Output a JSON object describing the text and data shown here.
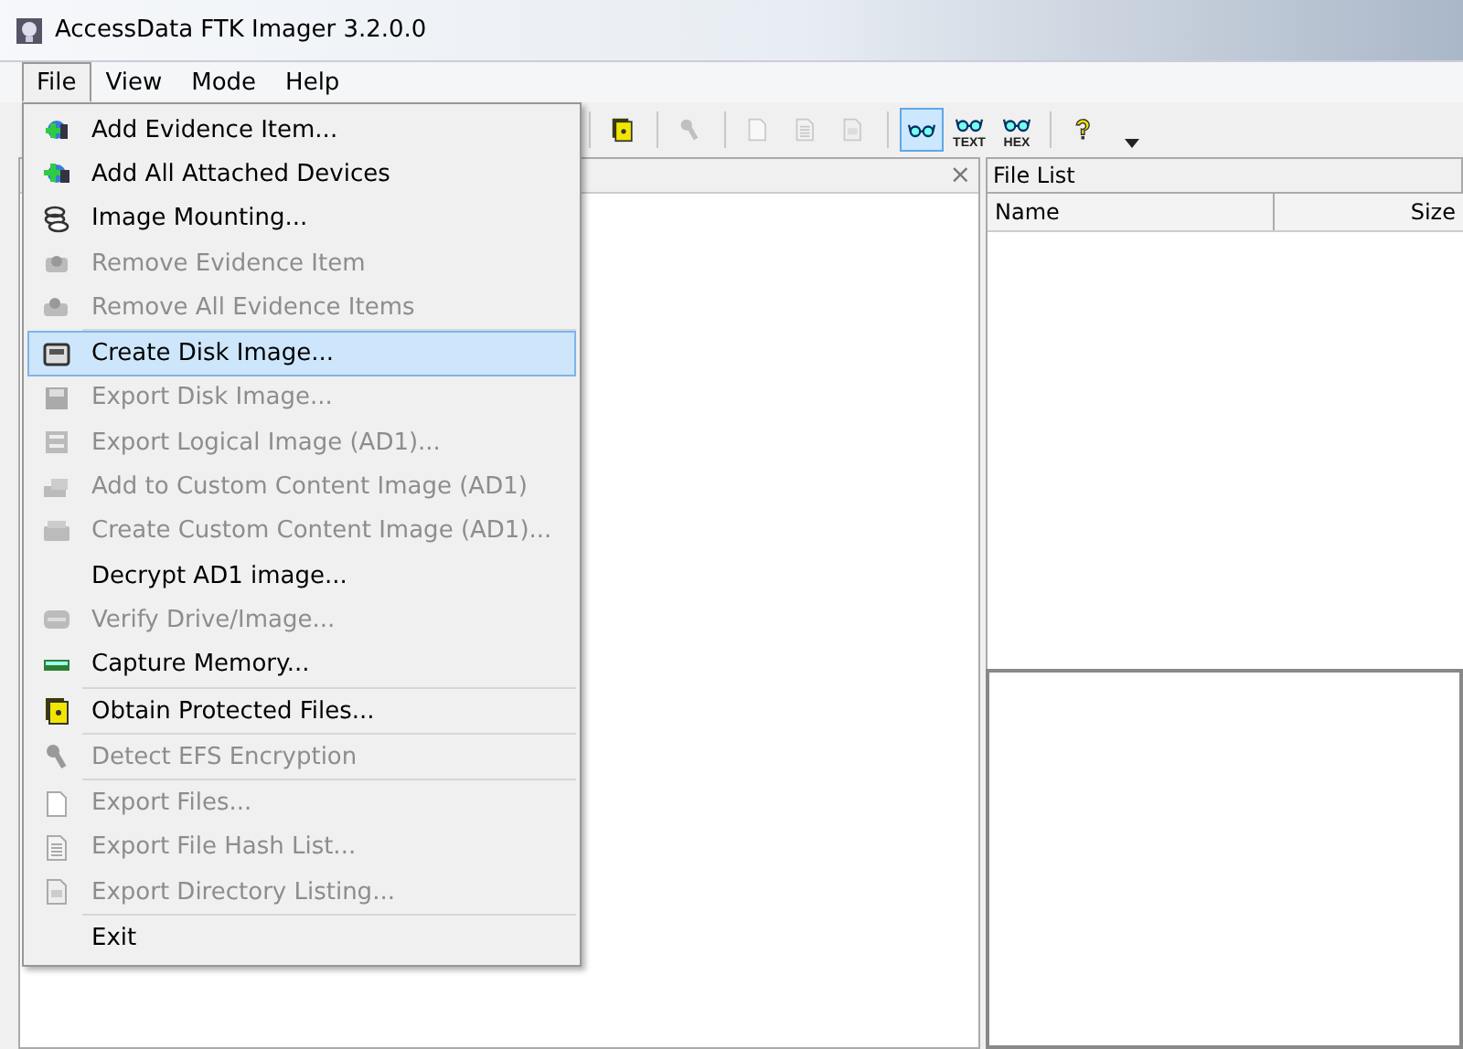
{
  "window": {
    "title": "AccessData FTK Imager 3.2.0.0"
  },
  "menu_bar": [
    {
      "label": "File",
      "selected": true
    },
    {
      "label": "View",
      "selected": false
    },
    {
      "label": "Mode",
      "selected": false
    },
    {
      "label": "Help",
      "selected": false
    }
  ],
  "file_menu": {
    "groups": [
      [
        {
          "label": "Add Evidence Item...",
          "disabled": false,
          "selected": false
        },
        {
          "label": "Add All Attached Devices",
          "disabled": false,
          "selected": false
        },
        {
          "label": "Image Mounting...",
          "disabled": false,
          "selected": false
        },
        {
          "label": "Remove Evidence Item",
          "disabled": true,
          "selected": false
        },
        {
          "label": "Remove All Evidence Items",
          "disabled": true,
          "selected": false
        }
      ],
      [
        {
          "label": "Create Disk Image...",
          "disabled": false,
          "selected": true
        },
        {
          "label": "Export Disk Image...",
          "disabled": true,
          "selected": false
        },
        {
          "label": "Export Logical Image (AD1)...",
          "disabled": true,
          "selected": false
        },
        {
          "label": "Add to Custom Content Image (AD1)",
          "disabled": true,
          "selected": false
        },
        {
          "label": "Create Custom Content Image (AD1)...",
          "disabled": true,
          "selected": false
        },
        {
          "label": "Decrypt AD1 image...",
          "disabled": false,
          "selected": false
        },
        {
          "label": "Verify Drive/Image...",
          "disabled": true,
          "selected": false
        },
        {
          "label": "Capture Memory...",
          "disabled": false,
          "selected": false
        }
      ],
      [
        {
          "label": "Obtain Protected Files...",
          "disabled": false,
          "selected": false
        }
      ],
      [
        {
          "label": "Detect EFS Encryption",
          "disabled": true,
          "selected": false
        }
      ],
      [
        {
          "label": "Export Files...",
          "disabled": true,
          "selected": false
        },
        {
          "label": "Export File Hash List...",
          "disabled": true,
          "selected": false
        },
        {
          "label": "Export Directory Listing...",
          "disabled": true,
          "selected": false
        }
      ],
      [
        {
          "label": "Exit",
          "disabled": false,
          "selected": false
        }
      ]
    ]
  },
  "toolbar": [
    {
      "kind": "separator"
    },
    {
      "kind": "button",
      "disabled": false,
      "selected": false
    },
    {
      "kind": "separator"
    },
    {
      "kind": "button",
      "disabled": true,
      "selected": false
    },
    {
      "kind": "separator"
    },
    {
      "kind": "button",
      "disabled": true,
      "selected": false
    },
    {
      "kind": "button",
      "disabled": true,
      "selected": false
    },
    {
      "kind": "button",
      "disabled": true,
      "selected": false
    },
    {
      "kind": "separator"
    },
    {
      "kind": "button",
      "disabled": false,
      "selected": true
    },
    {
      "kind": "button",
      "label": "TEXT",
      "disabled": false,
      "selected": false
    },
    {
      "kind": "button",
      "label": "HEX",
      "disabled": false,
      "selected": false
    },
    {
      "kind": "separator"
    },
    {
      "kind": "button",
      "disabled": false,
      "selected": false
    },
    {
      "kind": "dropdown"
    }
  ],
  "evidence_tree": {
    "close": "×"
  },
  "file_list": {
    "title": "File List",
    "columns": [
      "Name",
      "Size"
    ]
  }
}
